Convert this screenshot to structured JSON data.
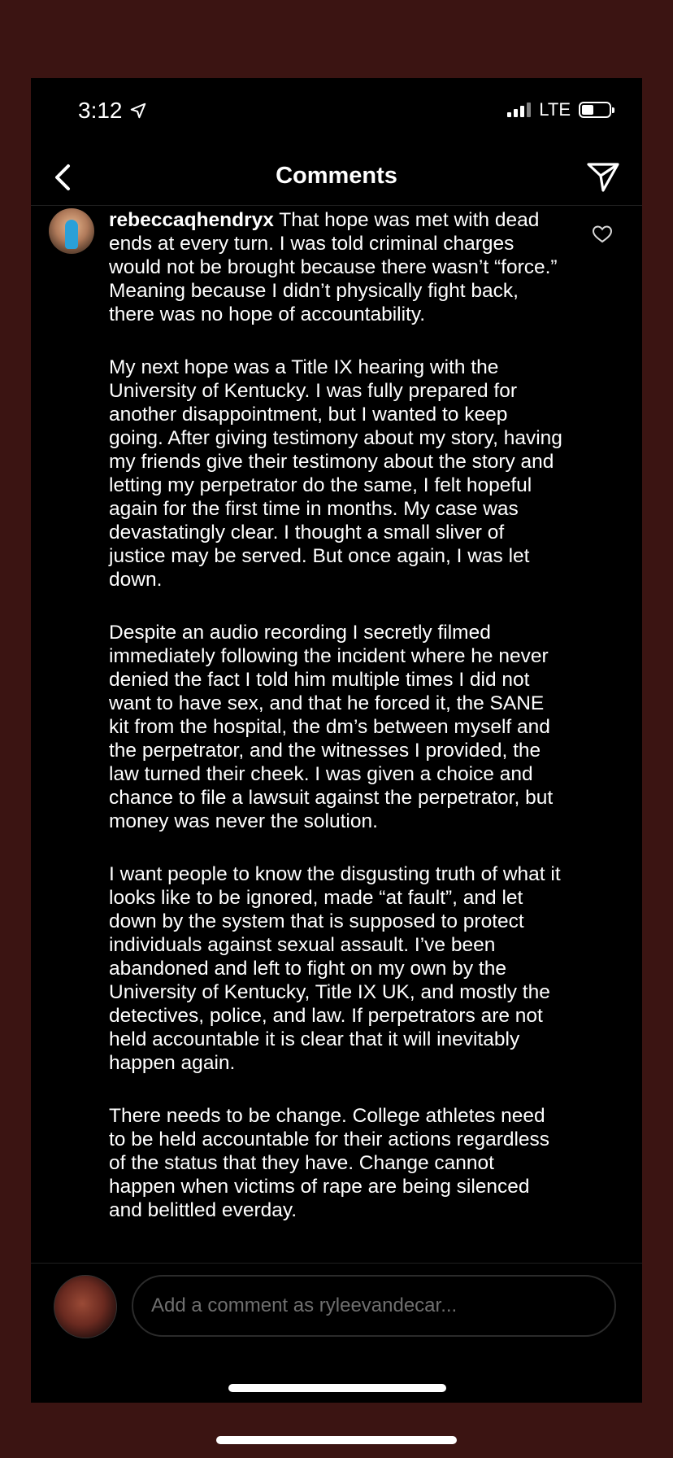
{
  "status_bar": {
    "time": "3:12",
    "network": "LTE",
    "location_icon": "location-arrow-icon",
    "signal_icon": "cell-signal-icon",
    "battery_icon": "battery-icon"
  },
  "header": {
    "title": "Comments",
    "back_icon": "chevron-left-icon",
    "share_icon": "paper-plane-icon"
  },
  "comment": {
    "username": "rebeccaqhendryx",
    "paragraphs": [
      "That hope was met with dead ends at every turn. I was told criminal charges would not be brought because there wasn’t “force.” Meaning because I didn’t physically fight back, there was no hope of accountability.",
      "My next hope was a Title IX hearing with the University of Kentucky. I was fully prepared for another disappointment, but I wanted to keep going. After giving testimony about my story, having my friends give their testimony about the story and letting my perpetrator do the same, I felt hopeful again for the first time in months. My case was devastatingly clear. I thought a small sliver of justice may be served. But once again, I was let down.",
      "Despite an audio recording I secretly filmed immediately following the incident where he never denied the fact I told him multiple times I did not want to have sex, and that he forced it, the SANE kit from the hospital, the dm’s between myself and the perpetrator, and the witnesses I provided, the law turned their cheek. I was given a choice and chance to file a lawsuit against the perpetrator, but money was never the solution.",
      "I want people to know the disgusting truth of what it looks like to be ignored, made “at fault”, and let down by the system that is supposed to protect individuals against sexual assault. I’ve been abandoned and left to fight on my own by the University of Kentucky, Title IX UK, and mostly the detectives, police, and law. If perpetrators are not held accountable it is clear that it will inevitably happen again.",
      "There needs to be change. College athletes need to be held accountable for their actions regardless of the status that they have. Change cannot happen when victims of rape are being silenced and belittled everday."
    ],
    "like_icon": "heart-outline-icon"
  },
  "composer": {
    "placeholder": "Add a comment as ryleevandecar..."
  },
  "colors": {
    "background_outer": "#3b1412",
    "screen_bg": "#000000",
    "text": "#ffffff",
    "placeholder": "#6f6f6f"
  }
}
